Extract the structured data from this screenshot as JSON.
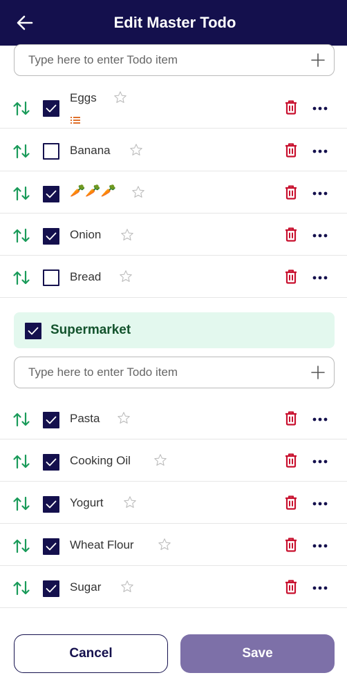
{
  "header": {
    "title": "Edit Master Todo"
  },
  "first_list": {
    "input_placeholder": "Type here to enter Todo item",
    "items": [
      {
        "label": "Eggs",
        "checked": true,
        "has_notes": true
      },
      {
        "label": "Banana",
        "checked": false
      },
      {
        "label": "🥕🥕🥕",
        "checked": true
      },
      {
        "label": "Onion",
        "checked": true
      },
      {
        "label": "Bread",
        "checked": false
      }
    ]
  },
  "section": {
    "name": "Supermarket",
    "checked": true
  },
  "second_list": {
    "input_placeholder": "Type here to enter Todo item",
    "items": [
      {
        "label": "Pasta",
        "checked": true
      },
      {
        "label": "Cooking Oil",
        "checked": true
      },
      {
        "label": "Yogurt",
        "checked": true
      },
      {
        "label": "Wheat Flour",
        "checked": true
      },
      {
        "label": "Sugar",
        "checked": true
      }
    ]
  },
  "footer": {
    "cancel_label": "Cancel",
    "save_label": "Save"
  },
  "colors": {
    "header_bg": "#14104d",
    "checkbox": "#14104d",
    "sort_icon": "#1a9b5a",
    "trash_icon": "#c8102e",
    "section_bg": "#e3f8ee",
    "section_text": "#13532d",
    "save_button": "#7d70a8",
    "notes_icon": "#e0702a"
  },
  "icons": {
    "back": "arrow-left-icon",
    "add": "plus-icon",
    "sort": "sort-arrows-icon",
    "favorite": "star-outline-icon",
    "delete": "trash-icon",
    "more": "more-dots-icon",
    "notes": "list-notes-icon"
  }
}
